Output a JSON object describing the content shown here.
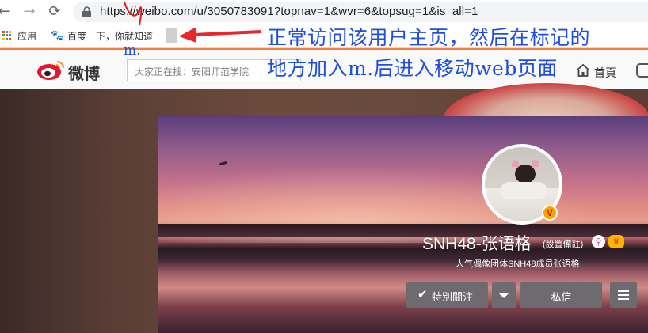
{
  "browser": {
    "url": "https://weibo.com/u/3050783091?topnav=1&wvr=6&topsug=1&is_all=1",
    "bookmarks": [
      {
        "label": "应用"
      },
      {
        "label": "百度一下，你就知道"
      }
    ]
  },
  "weibo": {
    "logo_text": "微博",
    "search_placeholder": "大家正在搜：安阳师范学院",
    "nav_home": "首頁"
  },
  "profile": {
    "name": "SNH48-张语格",
    "remark": "(設置備註)",
    "bio": "人气偶像团体SNH48成员张语格",
    "verified_mark": "V",
    "buttons": {
      "follow": "特別關注",
      "message": "私信"
    }
  },
  "annotation": {
    "line1": "正常访问该用户主页，然后在标记的",
    "line2": "地方加入m.后进入移动web页面",
    "insert_text": "m.",
    "color": "#1e4fe0",
    "arrow_color": "#e8262b"
  },
  "colors": {
    "weibo_accent": "#fa7d3c",
    "button_bg": "#6d6a70"
  }
}
